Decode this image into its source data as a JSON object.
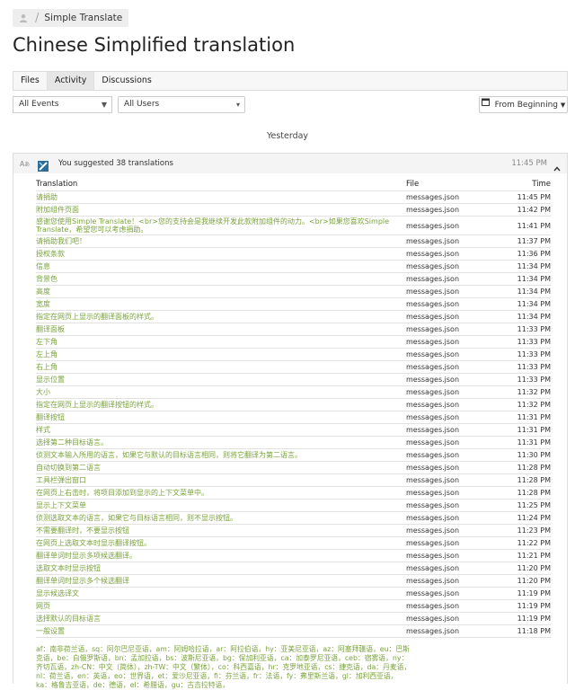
{
  "breadcrumb": {
    "project": "Simple Translate"
  },
  "page_title": "Chinese Simplified translation",
  "tabs": [
    {
      "label": "Files"
    },
    {
      "label": "Activity"
    },
    {
      "label": "Discussions"
    }
  ],
  "filters": {
    "events": "All Events",
    "users": "All Users",
    "range": "From Beginning"
  },
  "day_label": "Yesterday",
  "group": {
    "summary": "You suggested 38 translations",
    "time": "11:45 PM",
    "columns": {
      "translation": "Translation",
      "file": "File",
      "time": "Time"
    },
    "rows": [
      {
        "s": "请捐助",
        "f": "messages.json",
        "t": "11:45 PM"
      },
      {
        "s": "附加组件页面",
        "f": "messages.json",
        "t": "11:42 PM"
      },
      {
        "s": "感谢您使用Simple Translate！<br>您的支持会是我继续开发此款附加组件的动力。<br>如果您喜欢Simple Translate，希望您可以考虑捐助。",
        "f": "messages.json",
        "t": "11:41 PM"
      },
      {
        "s": "请捐助我们吧！",
        "f": "messages.json",
        "t": "11:37 PM"
      },
      {
        "s": "授权条款",
        "f": "messages.json",
        "t": "11:36 PM"
      },
      {
        "s": "信息",
        "f": "messages.json",
        "t": "11:34 PM"
      },
      {
        "s": "背景色",
        "f": "messages.json",
        "t": "11:34 PM"
      },
      {
        "s": "高度",
        "f": "messages.json",
        "t": "11:34 PM"
      },
      {
        "s": "宽度",
        "f": "messages.json",
        "t": "11:34 PM"
      },
      {
        "s": "指定在网页上显示的翻译面板的样式。",
        "f": "messages.json",
        "t": "11:34 PM"
      },
      {
        "s": "翻译面板",
        "f": "messages.json",
        "t": "11:33 PM"
      },
      {
        "s": "左下角",
        "f": "messages.json",
        "t": "11:33 PM"
      },
      {
        "s": "左上角",
        "f": "messages.json",
        "t": "11:33 PM"
      },
      {
        "s": "右上角",
        "f": "messages.json",
        "t": "11:33 PM"
      },
      {
        "s": "显示位置",
        "f": "messages.json",
        "t": "11:33 PM"
      },
      {
        "s": "大小",
        "f": "messages.json",
        "t": "11:32 PM"
      },
      {
        "s": "指定在网页上显示的翻译按钮的样式。",
        "f": "messages.json",
        "t": "11:32 PM"
      },
      {
        "s": "翻译按钮",
        "f": "messages.json",
        "t": "11:31 PM"
      },
      {
        "s": "样式",
        "f": "messages.json",
        "t": "11:31 PM"
      },
      {
        "s": "选择第二种目标语言。",
        "f": "messages.json",
        "t": "11:31 PM"
      },
      {
        "s": "侦测文本输入所用的语言，如果它与默认的目标语言相同，则将它翻译为第二语言。",
        "f": "messages.json",
        "t": "11:30 PM"
      },
      {
        "s": "自动切换到第二语言",
        "f": "messages.json",
        "t": "11:28 PM"
      },
      {
        "s": "工具栏弹出窗口",
        "f": "messages.json",
        "t": "11:28 PM"
      },
      {
        "s": "在网页上右击时，将项目添加到显示的上下文菜单中。",
        "f": "messages.json",
        "t": "11:28 PM"
      },
      {
        "s": "显示上下文菜单",
        "f": "messages.json",
        "t": "11:25 PM"
      },
      {
        "s": "侦测选取文本的语言，如果它与目标语言相同，则不显示按钮。",
        "f": "messages.json",
        "t": "11:24 PM"
      },
      {
        "s": "不需要翻译时，不要显示按钮",
        "f": "messages.json",
        "t": "11:23 PM"
      },
      {
        "s": "在网页上选取文本时显示翻译按钮。",
        "f": "messages.json",
        "t": "11:22 PM"
      },
      {
        "s": "翻译单词时显示多项候选翻译。",
        "f": "messages.json",
        "t": "11:21 PM"
      },
      {
        "s": "选取文本时显示按钮",
        "f": "messages.json",
        "t": "11:20 PM"
      },
      {
        "s": "翻译单词时显示多个候选翻译",
        "f": "messages.json",
        "t": "11:20 PM"
      },
      {
        "s": "显示候选译文",
        "f": "messages.json",
        "t": "11:19 PM"
      },
      {
        "s": "网页",
        "f": "messages.json",
        "t": "11:19 PM"
      },
      {
        "s": "选择默认的目标语言",
        "f": "messages.json",
        "t": "11:19 PM"
      },
      {
        "s": "一般设置",
        "f": "messages.json",
        "t": "11:18 PM"
      }
    ],
    "long_text": "af：南非荷兰语，sq：阿尔巴尼亚语，am：阿姆哈拉语，ar：阿拉伯语，hy：亚美尼亚语，az：阿塞拜疆语，eu：巴斯克语，be：白俄罗斯语，bn：孟加拉语，bs：波斯尼亚语，bg：保加利亚语，ca：加泰罗尼亚语，ceb：宿雾语，ny：齐切瓦语，zh-CN：中文（简体），zh-TW：中文（繁体），co：科西嘉语，hr：克罗地亚语，cs：捷克语，da：丹麦语，nl：荷兰语，en：英语，eo：世界语，et：爱沙尼亚语，fi：芬兰语，fr：法语，fy：弗里斯兰语，gl：加利西亚语，ka：格鲁吉亚语，de：德语，el：希腊语，gu：古吉拉特语，"
  }
}
